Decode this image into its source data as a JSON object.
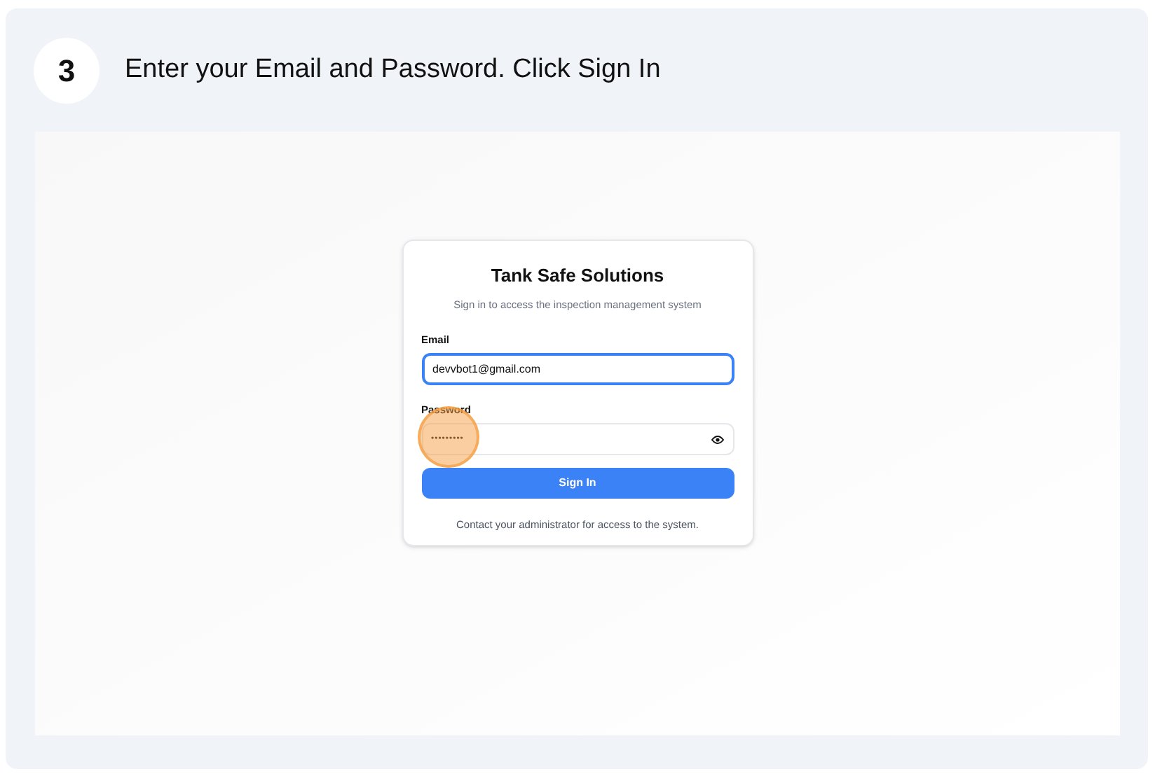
{
  "step": {
    "number": "3",
    "instruction": "Enter your Email and Password. Click Sign In"
  },
  "login": {
    "title": "Tank Safe Solutions",
    "subtitle": "Sign in to access the inspection management system",
    "fields": [
      {
        "label": "Email",
        "kind": "text",
        "value": "devvbot1@gmail.com",
        "focused": true,
        "clicked": false
      },
      {
        "label": "Password",
        "kind": "password",
        "value": "•••••••••",
        "focused": false,
        "clicked": true
      }
    ],
    "button": "Sign In",
    "footer": "Contact your administrator for access to the system."
  }
}
